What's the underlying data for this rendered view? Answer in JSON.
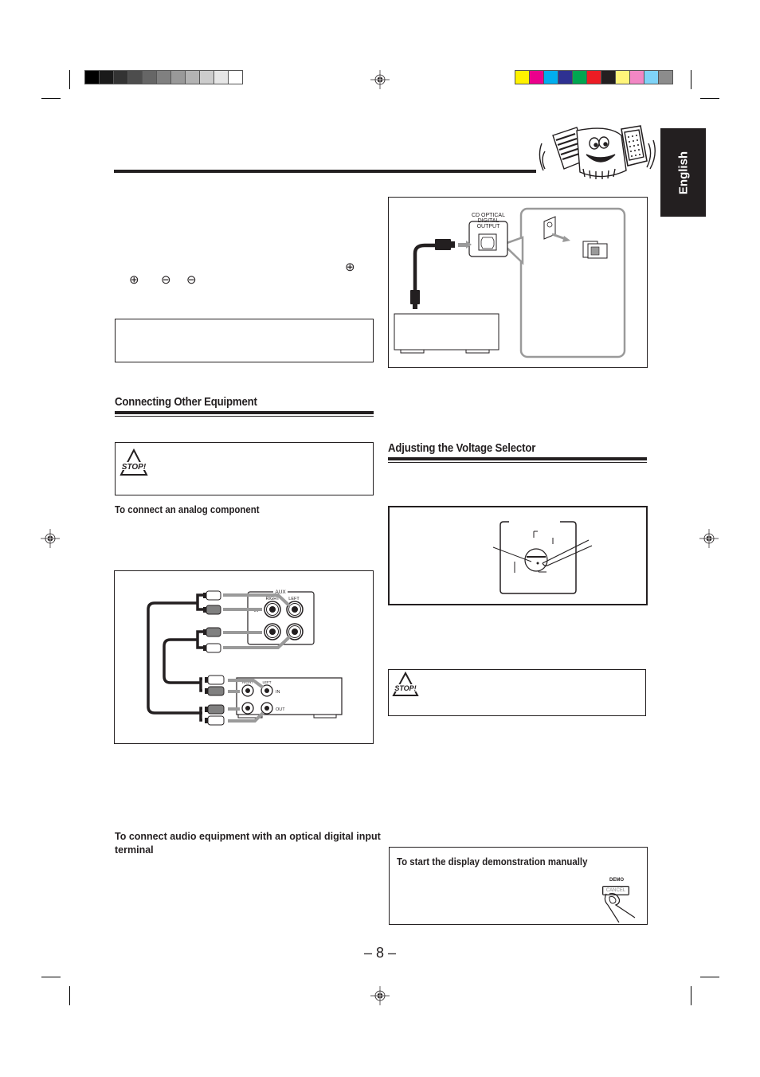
{
  "colors": {
    "grayscale_swatches": [
      "#000000",
      "#1a1a1a",
      "#333333",
      "#4d4d4d",
      "#666666",
      "#808080",
      "#999999",
      "#b3b3b3",
      "#cccccc",
      "#e6e6e6",
      "#ffffff"
    ],
    "color_swatches": [
      "#fff200",
      "#ec008c",
      "#00aeef",
      "#2e3192",
      "#00a651",
      "#ed1c24",
      "#231f20",
      "#fff57a",
      "#f287c4",
      "#7fd3f7",
      "#8c8c8c"
    ],
    "ink": "#231f20"
  },
  "language_tab": {
    "label": "English"
  },
  "mascot": {
    "icon": "accordion-mascot-icon"
  },
  "polarity_symbols": {
    "plus": "⊕",
    "minus": "⊖"
  },
  "sections": {
    "connecting_other_equipment": {
      "title": "Connecting Other Equipment",
      "caution_icon": "stop-warning-icon",
      "caution_label": "STOP!",
      "analog_subhead": "To connect an analog component",
      "optical_subhead": "To connect audio equipment with an optical digital input terminal"
    },
    "adjusting_voltage_selector": {
      "title": "Adjusting the Voltage Selector",
      "caution_icon": "stop-warning-icon",
      "caution_label": "STOP!"
    },
    "demo": {
      "subhead": "To start the display demonstration manually",
      "button_top_label": "DEMO",
      "button_label": "CANCEL"
    }
  },
  "optical_diagram": {
    "port_label_lines": [
      "CD OPTICAL",
      "DIGITAL",
      "OUTPUT"
    ]
  },
  "aux_diagram": {
    "group_label": "AUX",
    "channel_right": "RIGHT",
    "channel_left": "LEFT",
    "row_in": "IN",
    "row_out": "OUT",
    "device_right": "RIGHT",
    "device_left": "LEFT",
    "device_in": "IN",
    "device_out": "OUT"
  },
  "footer": {
    "page_number": "– 8 –"
  }
}
